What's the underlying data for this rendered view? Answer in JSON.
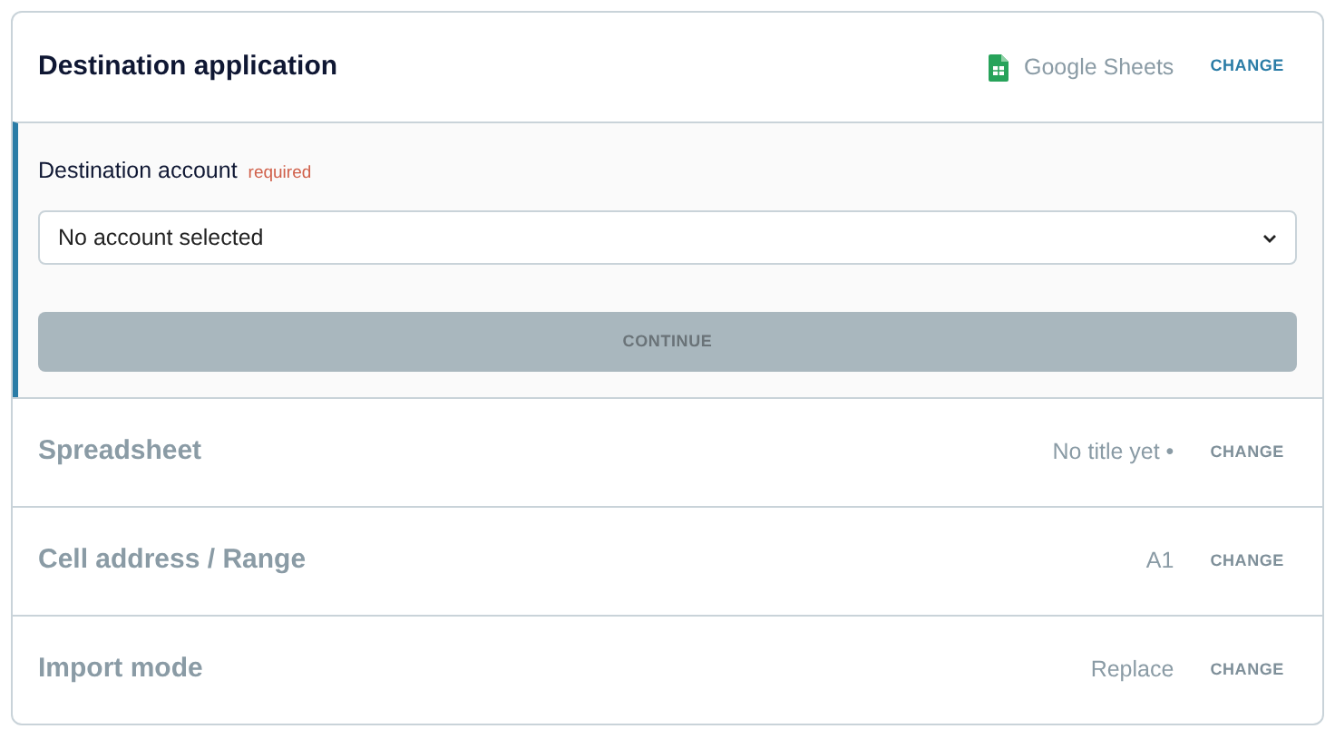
{
  "steps": [
    {
      "title": "Destination application",
      "kind": "app",
      "value": "Google Sheets",
      "action": "CHANGE",
      "active": true
    },
    {
      "title": "Spreadsheet",
      "kind": "text",
      "value": "No title yet •",
      "action": "CHANGE",
      "active": false
    },
    {
      "title": "Cell address / Range",
      "kind": "text",
      "value": "A1",
      "action": "CHANGE",
      "active": false
    },
    {
      "title": "Import mode",
      "kind": "text",
      "value": "Replace",
      "action": "CHANGE",
      "active": false
    }
  ],
  "account_form": {
    "label": "Destination account",
    "required": "required",
    "select_value": "No account selected",
    "button": {
      "label": "CONTINUE",
      "disabled": true
    }
  }
}
